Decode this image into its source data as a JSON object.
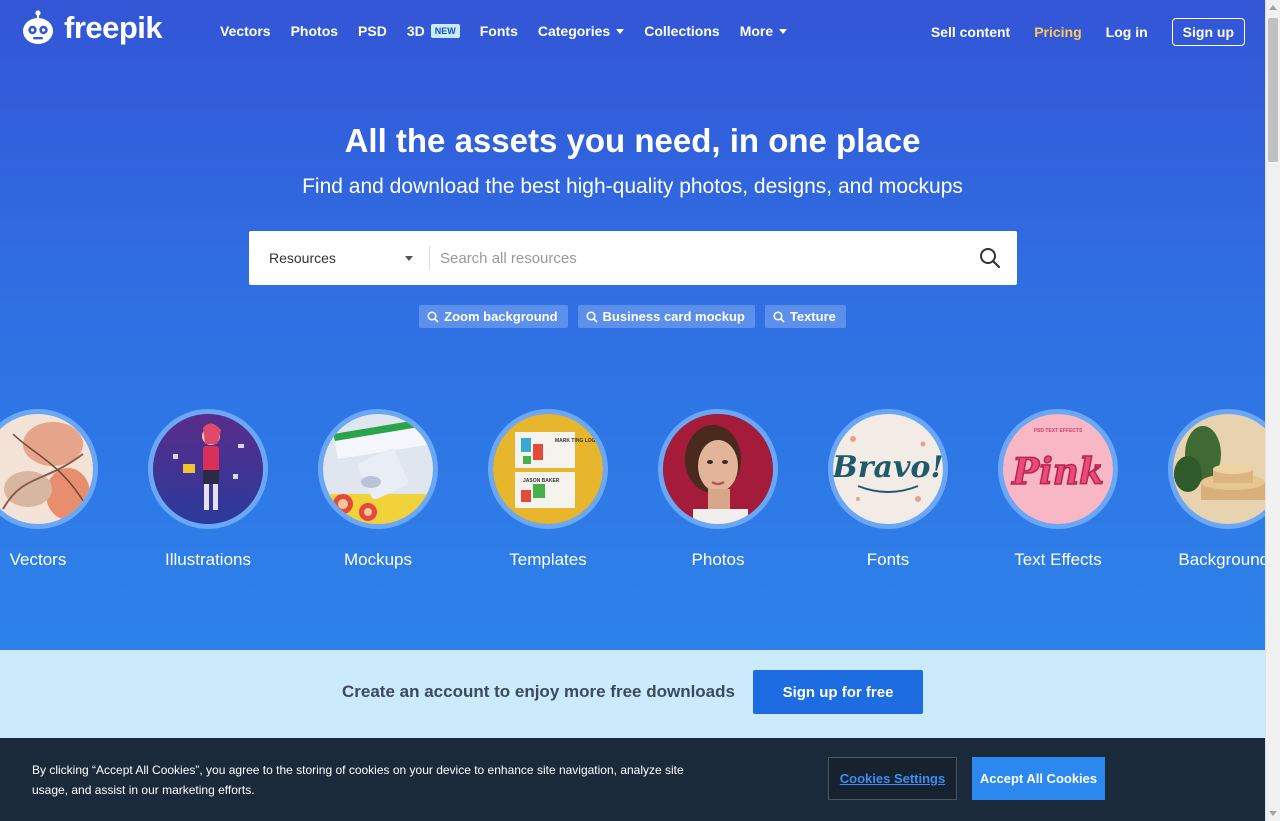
{
  "header": {
    "logo_text": "freepik",
    "nav": [
      {
        "label": "Vectors",
        "caret": false
      },
      {
        "label": "Photos",
        "caret": false
      },
      {
        "label": "PSD",
        "caret": false
      },
      {
        "label": "3D",
        "badge": "NEW",
        "caret": false
      },
      {
        "label": "Fonts",
        "caret": false
      },
      {
        "label": "Categories",
        "caret": true
      },
      {
        "label": "Collections",
        "caret": false
      },
      {
        "label": "More",
        "caret": true
      }
    ],
    "sell_content": "Sell content",
    "pricing": "Pricing",
    "login": "Log in",
    "signup": "Sign up"
  },
  "hero": {
    "title": "All the assets you need, in one place",
    "subtitle": "Find and download the best high-quality photos, designs, and mockups"
  },
  "search": {
    "selected_type": "Resources",
    "placeholder": "Search all resources",
    "value": ""
  },
  "suggested_tags": [
    "Zoom background",
    "Business card mockup",
    "Texture"
  ],
  "categories": [
    {
      "label": "Vectors",
      "icon": "abstract-watercolor-thumbnail"
    },
    {
      "label": "Illustrations",
      "icon": "character-illustration-thumbnail"
    },
    {
      "label": "Mockups",
      "icon": "packaging-mockup-thumbnail"
    },
    {
      "label": "Templates",
      "icon": "business-card-template-thumbnail"
    },
    {
      "label": "Photos",
      "icon": "portrait-photo-thumbnail"
    },
    {
      "label": "Fonts",
      "icon": "lettering-bravo-thumbnail"
    },
    {
      "label": "Text Effects",
      "icon": "pink-text-effect-thumbnail"
    },
    {
      "label": "Backgrounds",
      "icon": "podium-plants-thumbnail"
    }
  ],
  "thumb_text": {
    "template_card_1": "MARK TING LOGO",
    "template_card_2": "JASON BAKER",
    "fonts_word": "Bravo!",
    "text_effect_caption": "PSD TEXT EFFECTS",
    "text_effect_word": "Pink"
  },
  "cta": {
    "text": "Create an account to enjoy more free downloads",
    "button": "Sign up for free"
  },
  "cookie_banner": {
    "text": "By clicking “Accept All Cookies”, you agree to the storing of cookies on your device to enhance site navigation, analyze site usage, and assist in our marketing efforts.",
    "settings_button": "Cookies Settings",
    "accept_button": "Accept All Cookies"
  },
  "colors": {
    "hero_top": "#3355d6",
    "hero_bottom": "#2d82ea",
    "pricing": "#ffc95a",
    "cta_background": "#cbeafb",
    "cta_button": "#1d6ce2",
    "cookie_background": "#1b2a3b",
    "accept_button": "#2b88ee"
  }
}
